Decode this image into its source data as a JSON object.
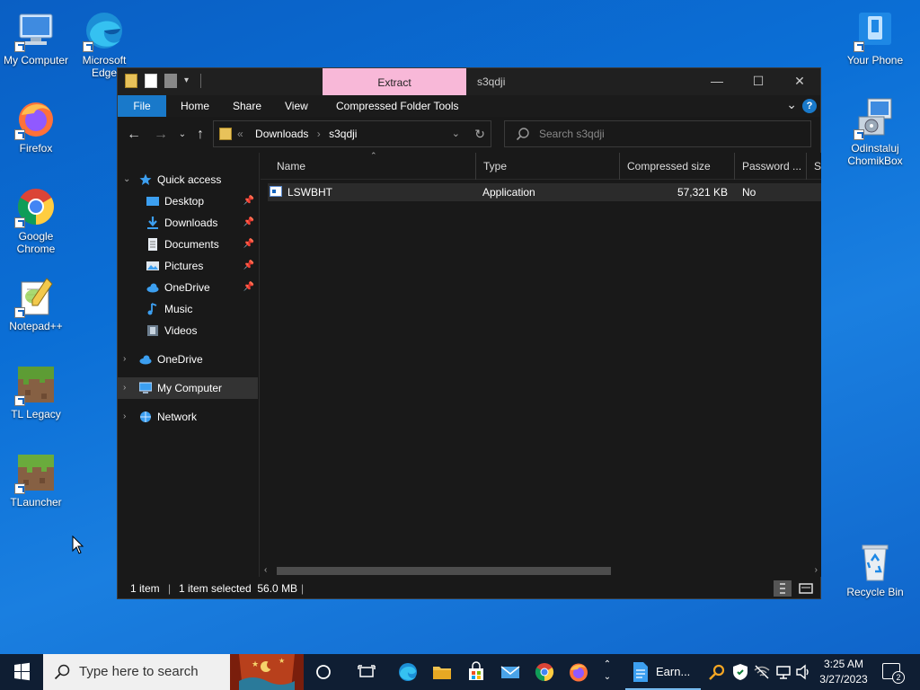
{
  "desktop": {
    "icons": [
      {
        "label": "My Computer"
      },
      {
        "label": "Microsoft Edge"
      },
      {
        "label": "Firefox"
      },
      {
        "label": "Google Chrome"
      },
      {
        "label": "Notepad++"
      },
      {
        "label": "TL Legacy"
      },
      {
        "label": "TLauncher"
      },
      {
        "label": "Your Phone"
      },
      {
        "label": "Odinstaluj ChomikBox"
      },
      {
        "label": "Recycle Bin"
      }
    ]
  },
  "explorer": {
    "title": "s3qdji",
    "contextual_tab": "Extract",
    "ribbon_tabs": [
      "File",
      "Home",
      "Share",
      "View",
      "Compressed Folder Tools"
    ],
    "help": "?",
    "address": {
      "crumbs": [
        "Downloads",
        "s3qdji"
      ]
    },
    "search": {
      "placeholder": "Search s3qdji"
    },
    "nav": {
      "quick_access": "Quick access",
      "quick_items": [
        "Desktop",
        "Downloads",
        "Documents",
        "Pictures",
        "OneDrive",
        "Music",
        "Videos"
      ],
      "onedrive": "OneDrive",
      "my_computer": "My Computer",
      "network": "Network"
    },
    "columns": [
      "Name",
      "Type",
      "Compressed size",
      "Password ...",
      "Si"
    ],
    "rows": [
      {
        "name": "LSWBHT",
        "type": "Application",
        "compressed_size": "57,321 KB",
        "password": "No"
      }
    ],
    "status": {
      "count": "1 item",
      "selection": "1 item selected  56.0 MB"
    }
  },
  "taskbar": {
    "search_placeholder": "Type here to search",
    "running_app": "Earn...",
    "clock_time": "3:25 AM",
    "clock_date": "3/27/2023",
    "notifications": "2"
  },
  "colors": {
    "accent": "#1979ca",
    "extract_tab": "#f8b8d8",
    "window_bg": "#191919",
    "taskbar_bg": "#0f1e33"
  }
}
